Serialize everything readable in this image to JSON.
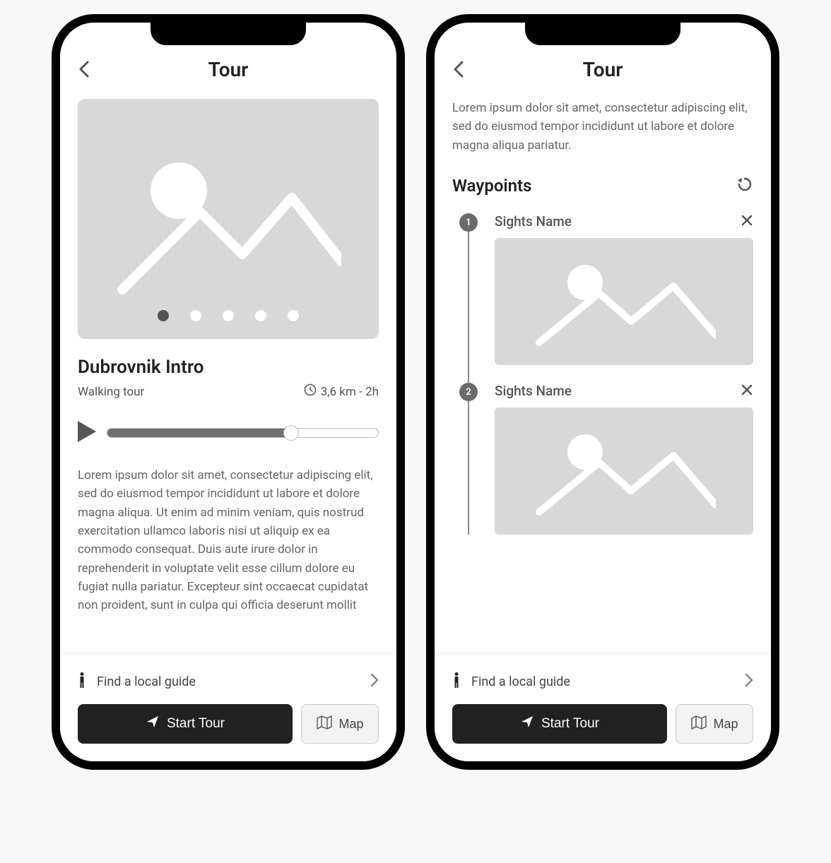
{
  "screen1": {
    "header_title": "Tour",
    "tour_title": "Dubrovnik Intro",
    "tour_type": "Walking tour",
    "distance_duration": "3,6 km - 2h",
    "carousel_dots": 5,
    "carousel_active_index": 0,
    "audio_progress_percent": 68,
    "description": "Lorem ipsum dolor sit amet, consectetur adipiscing elit, sed do eiusmod tempor incididunt ut labore et dolore magna aliqua. Ut enim ad minim veniam, quis nostrud exercitation ullamco laboris nisi ut aliquip ex ea commodo consequat. Duis aute irure dolor in reprehenderit in voluptate velit esse cillum dolore eu fugiat nulla pariatur. Excepteur sint occaecat cupidatat non proident, sunt in culpa qui officia deserunt mollit"
  },
  "screen2": {
    "header_title": "Tour",
    "intro_text": "Lorem ipsum dolor sit amet, consectetur adipiscing elit, sed do eiusmod tempor incididunt ut labore et dolore magna aliqua pariatur.",
    "waypoints_title": "Waypoints",
    "waypoints": [
      {
        "num": "1",
        "name": "Sights Name"
      },
      {
        "num": "2",
        "name": "Sights Name"
      }
    ]
  },
  "bottom": {
    "guide_label": "Find a local guide",
    "start_label": "Start Tour",
    "map_label": "Map"
  }
}
